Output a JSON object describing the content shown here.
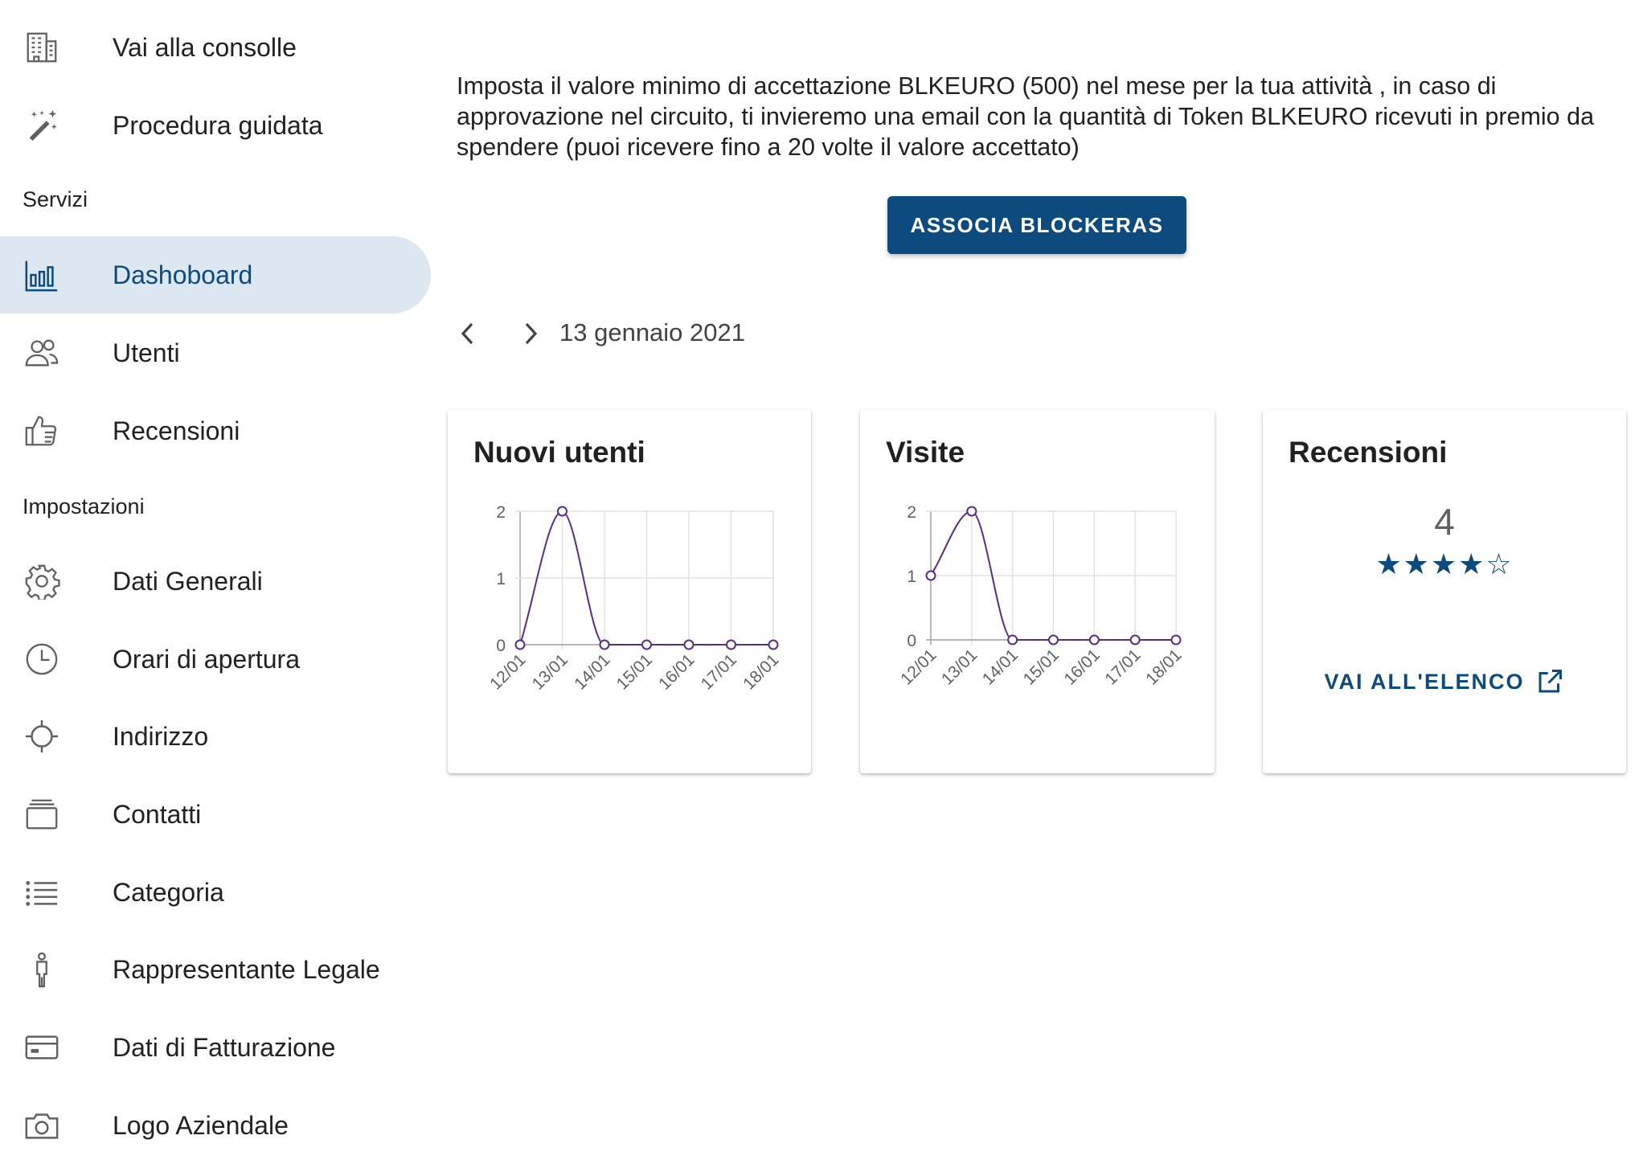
{
  "sidebar": {
    "top_items": [
      {
        "label": "Vai alla consolle",
        "icon": "building-icon"
      },
      {
        "label": "Procedura guidata",
        "icon": "magic-wand-icon"
      }
    ],
    "sections": [
      {
        "title": "Servizi",
        "items": [
          {
            "label": "Dashoboard",
            "icon": "bar-chart-icon",
            "active": true
          },
          {
            "label": "Utenti",
            "icon": "users-icon"
          },
          {
            "label": "Recensioni",
            "icon": "thumbs-up-icon"
          }
        ]
      },
      {
        "title": "Impostazioni",
        "items": [
          {
            "label": "Dati Generali",
            "icon": "gear-icon"
          },
          {
            "label": "Orari di apertura",
            "icon": "clock-icon"
          },
          {
            "label": "Indirizzo",
            "icon": "crosshair-icon"
          },
          {
            "label": "Contatti",
            "icon": "contacts-stack-icon"
          },
          {
            "label": "Categoria",
            "icon": "list-icon"
          },
          {
            "label": "Rappresentante Legale",
            "icon": "person-icon"
          },
          {
            "label": "Dati di Fatturazione",
            "icon": "credit-card-icon"
          },
          {
            "label": "Logo Aziendale",
            "icon": "camera-icon"
          }
        ]
      }
    ]
  },
  "main": {
    "intro_text": "Imposta il valore minimo di accettazione BLKEURO (500) nel mese per la tua attività , in caso di approvazione nel circuito, ti invieremo una email con la quantità di Token BLKEURO ricevuti in premio da spendere (puoi ricevere fino a 20 volte il valore accettato)",
    "button_label": "ASSOCIA BLOCKERAS",
    "date_label": "13 gennaio 2021",
    "cards": {
      "new_users": {
        "title": "Nuovi utenti"
      },
      "visits": {
        "title": "Visite"
      },
      "reviews": {
        "title": "Recensioni",
        "count": "4",
        "stars": "★★★★☆",
        "rating": 4,
        "link_label": "VAI ALL'ELENCO"
      }
    },
    "accent_color": "#0d4a7e",
    "active_bg_color": "#dde7f1",
    "line_color": "#5b2c83"
  },
  "chart_data": [
    {
      "type": "line",
      "title": "Nuovi utenti",
      "categories": [
        "12/01",
        "13/01",
        "14/01",
        "15/01",
        "16/01",
        "17/01",
        "18/01"
      ],
      "values": [
        0,
        2,
        0,
        0,
        0,
        0,
        0
      ],
      "ylim": [
        0,
        2
      ],
      "yticks": [
        "0",
        "1",
        "2"
      ],
      "grid": true
    },
    {
      "type": "line",
      "title": "Visite",
      "categories": [
        "12/01",
        "13/01",
        "14/01",
        "15/01",
        "16/01",
        "17/01",
        "18/01"
      ],
      "values": [
        1,
        2,
        0,
        0,
        0,
        0,
        0
      ],
      "ylim": [
        0,
        2
      ],
      "yticks": [
        "0",
        "1",
        "2"
      ],
      "grid": true
    }
  ]
}
